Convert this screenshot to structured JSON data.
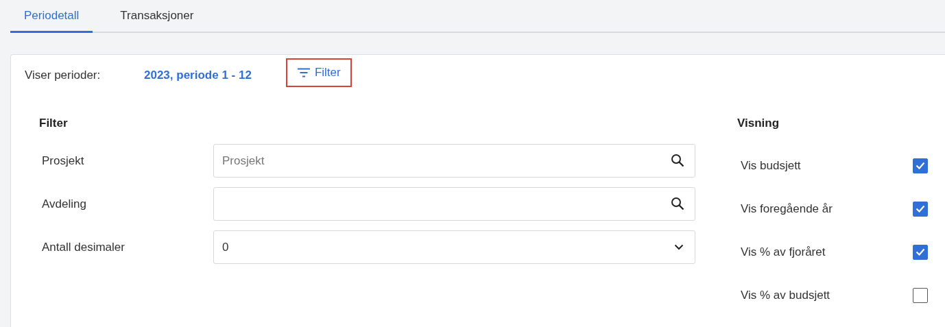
{
  "tabs": [
    {
      "label": "Periodetall",
      "selected": true
    },
    {
      "label": "Transaksjoner",
      "selected": false
    }
  ],
  "header": {
    "label": "Viser perioder:",
    "period": "2023, periode 1 - 12",
    "filter_button": {
      "label": "Filter",
      "highlighted": true
    }
  },
  "filter": {
    "title": "Filter",
    "fields": [
      {
        "label": "Prosjekt",
        "kind": "search",
        "placeholder": "Prosjekt"
      },
      {
        "label": "Avdeling",
        "kind": "search"
      },
      {
        "label": "Antall desimaler",
        "kind": "select",
        "value": "0"
      }
    ]
  },
  "view": {
    "title": "Visning",
    "options": [
      {
        "label": "Vis budsjett",
        "checked": true
      },
      {
        "label": "Vis foregående år",
        "checked": true
      },
      {
        "label": "Vis % av fjoråret",
        "checked": true
      },
      {
        "label": "Vis % av budsjett",
        "checked": false
      }
    ]
  }
}
